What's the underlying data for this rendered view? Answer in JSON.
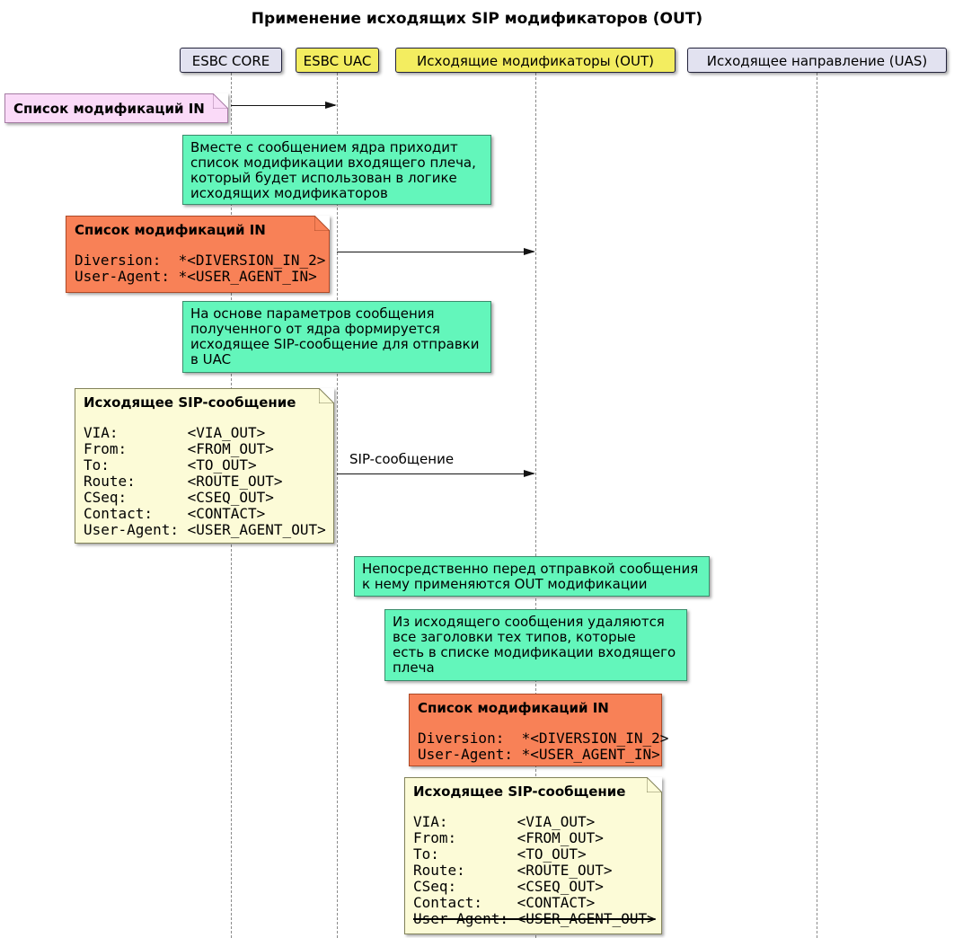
{
  "title": "Применение исходящих SIP модификаторов (OUT)",
  "participants": [
    {
      "label": "ESBC CORE"
    },
    {
      "label": "ESBC UAC"
    },
    {
      "label": "Исходящие модификаторы (OUT)"
    },
    {
      "label": "Исходящее направление (UAS)"
    }
  ],
  "messages": {
    "m3_label": "SIP-сообщение"
  },
  "notes": {
    "pink": {
      "title": "Список модификаций IN"
    },
    "green1": {
      "lines": [
        "Вместе с сообщением ядра приходит",
        "список модификации входящего плеча,",
        "который будет использован в логике",
        "исходящих модификаторов"
      ]
    },
    "orange1": {
      "title": "Список модификаций IN",
      "lines": [
        "Diversion:  *<DIVERSION_IN_2>",
        "User-Agent: *<USER_AGENT_IN>"
      ]
    },
    "green2": {
      "lines": [
        "На основе параметров сообщения",
        "полученного от ядра формируется",
        "исходящее SIP-сообщение для отправки",
        "в UAC"
      ]
    },
    "cream1": {
      "title": "Исходящее SIP-сообщение",
      "lines": [
        "VIA:        <VIA_OUT>",
        "From:       <FROM_OUT>",
        "To:         <TO_OUT>",
        "Route:      <ROUTE_OUT>",
        "CSeq:       <CSEQ_OUT>",
        "Contact:    <CONTACT>",
        "User-Agent: <USER_AGENT_OUT>"
      ]
    },
    "green3": {
      "lines": [
        "Непосредственно перед отправкой сообщения",
        "к нему применяются OUT модификации"
      ]
    },
    "green4": {
      "lines": [
        "Из исходящего сообщения удаляются",
        "все заголовки тех типов, которые",
        "есть в списке модификации входящего",
        "плеча"
      ]
    },
    "orange2": {
      "title": "Список модификаций IN",
      "lines": [
        "Diversion:  *<DIVERSION_IN_2>",
        "User-Agent: *<USER_AGENT_IN>"
      ]
    },
    "cream2": {
      "title": "Исходящее SIP-сообщение",
      "lines": [
        "VIA:        <VIA_OUT>",
        "From:       <FROM_OUT>",
        "To:         <TO_OUT>",
        "Route:      <ROUTE_OUT>",
        "CSeq:       <CSEQ_OUT>",
        "Contact:    <CONTACT>",
        "User-Agent: <USER_AGENT_OUT>"
      ]
    }
  },
  "colors": {
    "participant_lavender": "#e2e2f0",
    "participant_yellow": "#f3ed60",
    "note_pink": "#fadaf8",
    "note_green": "#63f6bb",
    "note_orange": "#f88157",
    "note_cream": "#fcfbd7",
    "lifeline_gray": "#8b8b8b",
    "arrow_black": "#141414"
  }
}
